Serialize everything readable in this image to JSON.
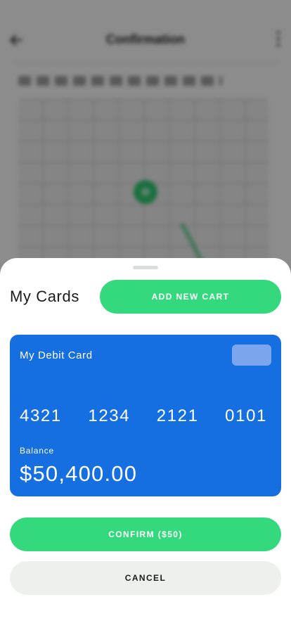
{
  "background": {
    "title": "Confirmation"
  },
  "sheet": {
    "title": "My Cards",
    "add_button_label": "ADD NEW CART"
  },
  "card": {
    "name": "My Debit Card",
    "number_groups": [
      "4321",
      "1234",
      "2121",
      "0101"
    ],
    "balance_label": "Balance",
    "balance_amount": "$50,400.00",
    "color": "#166fe0"
  },
  "actions": {
    "confirm_label": "CONFIRM ($50)",
    "cancel_label": "CANCEL"
  },
  "colors": {
    "accent": "#35d97d",
    "cancel_bg": "#eef0ee"
  },
  "icons": {
    "back": "arrow-left-icon",
    "menu": "more-vertical-icon",
    "map_pin": "map-pin-icon"
  }
}
